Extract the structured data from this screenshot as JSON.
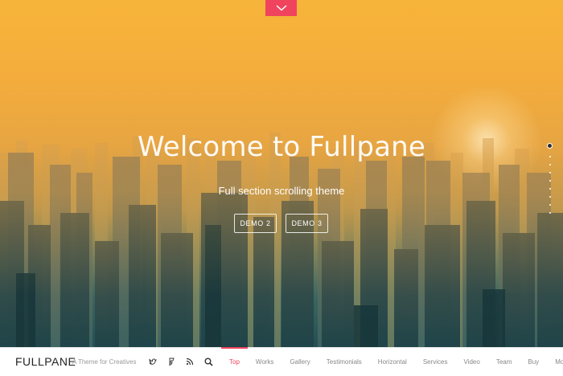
{
  "hero": {
    "title": "Welcome to Fullpane",
    "subtitle": "Full section scrolling theme",
    "buttons": [
      {
        "label": "DEMO 2"
      },
      {
        "label": "DEMO 3"
      }
    ],
    "toggle_icon": "chevron-down-icon",
    "accent_color": "#f0435e",
    "section_dots": {
      "count": 9,
      "active_index": 0
    }
  },
  "footer": {
    "brand": "FULLPANE",
    "tagline": "A Theme for Creatives",
    "social_icons": [
      "twitter-icon",
      "foursquare-icon",
      "rss-icon",
      "search-icon"
    ],
    "nav": [
      {
        "label": "Top",
        "active": true
      },
      {
        "label": "Works"
      },
      {
        "label": "Gallery"
      },
      {
        "label": "Testimonials"
      },
      {
        "label": "Horizontal"
      },
      {
        "label": "Services"
      },
      {
        "label": "Video"
      },
      {
        "label": "Team"
      },
      {
        "label": "Buy"
      },
      {
        "label": "More"
      }
    ]
  }
}
